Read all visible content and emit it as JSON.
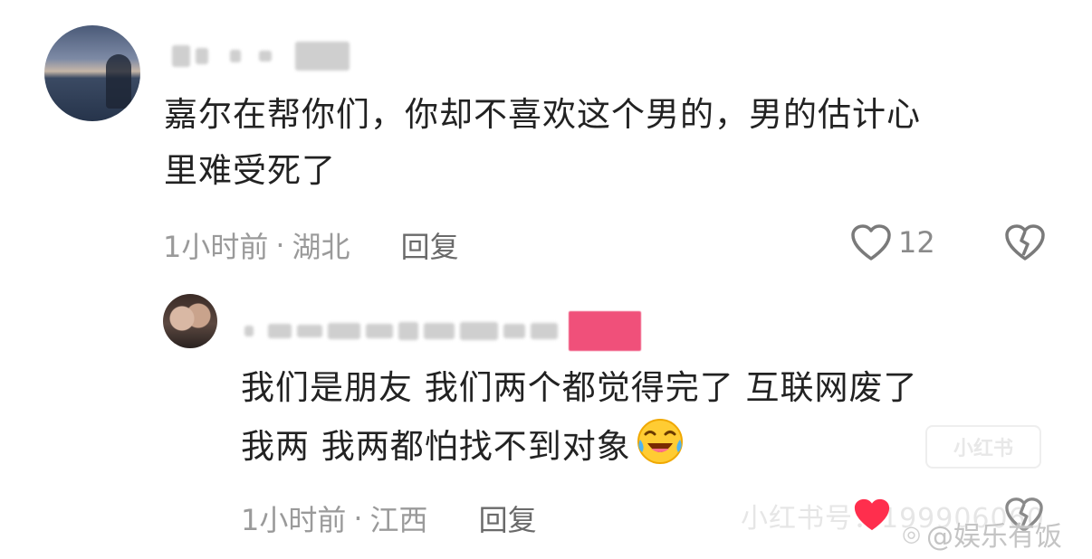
{
  "comments": [
    {
      "text_lines": [
        "嘉尔在帮你们，你却不喜欢这个男的，男的估计心",
        "里难受死了"
      ],
      "time": "1小时前",
      "separator": "·",
      "location": "湖北",
      "reply_label": "回复",
      "like_count": "12",
      "liked": false
    },
    {
      "text_lines": [
        "我们是朋友 我们两个都觉得完了 互联网废了",
        "我两 我两都怕找不到对象"
      ],
      "time": "1小时前",
      "separator": "·",
      "location": "江西",
      "reply_label": "回复",
      "liked": true
    }
  ],
  "watermarks": {
    "logo_text": "小红书",
    "id_text": "小红书号：199906060",
    "weibo_text": "@娱乐有饭"
  },
  "colors": {
    "text": "#222222",
    "meta": "#9a9a9a",
    "like_active": "#ff2e4d",
    "blur_accent": "#f0507a"
  },
  "icons": {
    "like": "heart-outline-icon",
    "dislike": "broken-heart-icon",
    "liked": "heart-filled-icon",
    "emoji": "laughing-crying-emoji-icon"
  }
}
